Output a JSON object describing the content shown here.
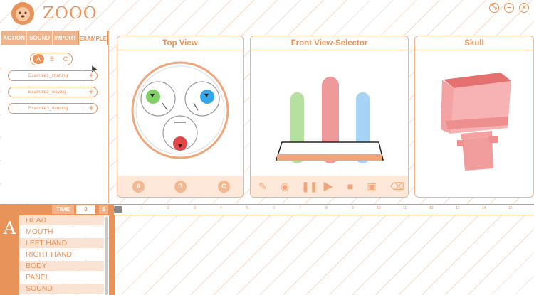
{
  "app": {
    "title": "ZOOO"
  },
  "window_controls": {
    "restore": "⤡",
    "minimize": "–",
    "close": "×"
  },
  "left_panel": {
    "tabs": [
      "ACTION",
      "SOUND",
      "IMPORT",
      "EXAMPLE"
    ],
    "active_tab": "EXAMPLE",
    "segments": [
      "A",
      "B",
      "C"
    ],
    "selected_segment": "A",
    "examples": [
      "Example1_chatting",
      "Example2_waving",
      "Example3_dancing"
    ]
  },
  "panels": {
    "top_view": {
      "title": "Top View",
      "buttons": [
        "A",
        "B",
        "C"
      ]
    },
    "front_view": {
      "title": "Front View-Selector"
    },
    "skull": {
      "title": "Skull"
    }
  },
  "timeline": {
    "time_label": "TIME",
    "time_value": "0",
    "s_label": "S",
    "ticks": [
      "1",
      "2",
      "3",
      "4",
      "5",
      "6",
      "7",
      "8",
      "9",
      "10",
      "11",
      "12",
      "13",
      "14",
      "15"
    ],
    "channel_letter": "A",
    "tracks": [
      "HEAD",
      "MOUTH",
      "LEFT HAND",
      "RIGHT HAND",
      "BODY",
      "PANEL",
      "SOUND"
    ]
  },
  "colors": {
    "accent": "#e8935a",
    "green": "#7fd065",
    "blue": "#34a7ea",
    "red": "#e04848"
  }
}
